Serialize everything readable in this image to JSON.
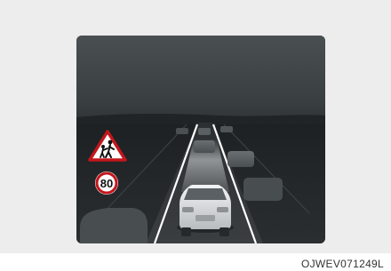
{
  "figure_code": "OJWEV071249L",
  "speed_limit": {
    "value": "80",
    "ring_color": "#c4161c"
  },
  "icons": {
    "warning_sign": "pedestrian-crossing-warning-icon",
    "speed_sign": "speed-limit-sign-icon",
    "ego_vehicle": "ego-vehicle-icon"
  },
  "colors": {
    "background": "#ededed",
    "display": "#2c3032",
    "lane_lines": "#ffffff"
  }
}
